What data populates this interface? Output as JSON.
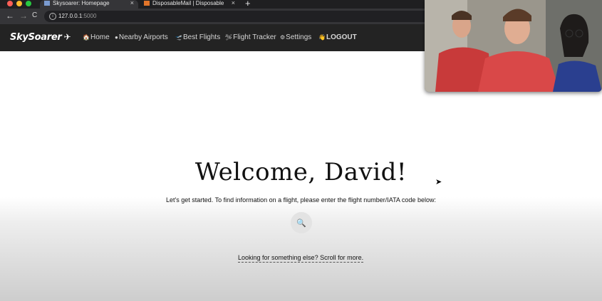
{
  "browser": {
    "tabs": [
      {
        "title": "Skysoarer: Homepage",
        "close": "×"
      },
      {
        "title": "DisposableMail | Disposable",
        "close": "×"
      }
    ],
    "new_tab": "+",
    "url_host": "127.0.0.1",
    "url_port": ":5000",
    "back_icon": "←",
    "forward_icon": "→",
    "reload_icon": "C"
  },
  "site": {
    "brand": "SkySoarer",
    "nav": [
      {
        "icon": "🏠",
        "label": "Home"
      },
      {
        "icon": "●",
        "label": "Nearby Airports"
      },
      {
        "icon": "🛫",
        "label": "Best Flights"
      },
      {
        "icon": "🛩",
        "label": "Flight Tracker"
      },
      {
        "icon": "⚙",
        "label": "Settings"
      },
      {
        "icon": "👋",
        "label": "LOGOUT"
      }
    ]
  },
  "main": {
    "welcome": "Welcome, David!",
    "subtitle": "Let's get started. To find information on a flight, please enter the flight number/IATA code below:",
    "search_icon": "🔍",
    "scroll_link": "Looking for something else? Scroll for more."
  },
  "colors": {
    "nav_bg": "#232323",
    "chrome_bg": "#1f1f21"
  }
}
